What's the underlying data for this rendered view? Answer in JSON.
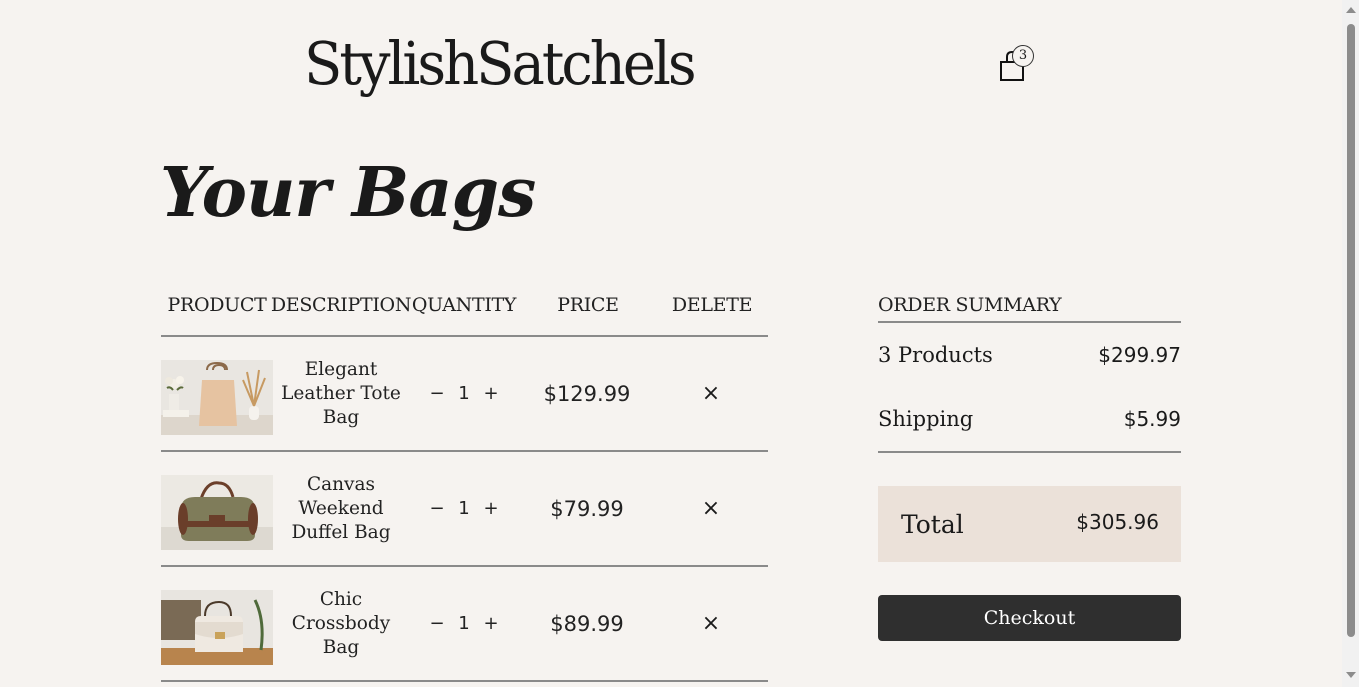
{
  "header": {
    "brand": "StylishSatchels",
    "cart_count": "3"
  },
  "page_title": "Your Bags",
  "table": {
    "headers": {
      "product": "PRODUCT",
      "description": "DESCRIPTION",
      "quantity": "QUANTITY",
      "price": "PRICE",
      "delete": "DELETE"
    },
    "rows": [
      {
        "description": "Elegant Leather Tote Bag",
        "qty_minus": "−",
        "quantity": "1",
        "qty_plus": "+",
        "price": "$129.99",
        "delete": "×"
      },
      {
        "description": "Canvas Weekend Duffel Bag",
        "qty_minus": "−",
        "quantity": "1",
        "qty_plus": "+",
        "price": "$79.99",
        "delete": "×"
      },
      {
        "description": "Chic Crossbody Bag",
        "qty_minus": "−",
        "quantity": "1",
        "qty_plus": "+",
        "price": "$89.99",
        "delete": "×"
      }
    ]
  },
  "summary": {
    "title": "ORDER SUMMARY",
    "products_label": "3 Products",
    "products_value": "$299.97",
    "shipping_label": "Shipping",
    "shipping_value": "$5.99",
    "total_label": "Total",
    "total_value": "$305.96",
    "checkout_label": "Checkout"
  },
  "colors": {
    "background": "#f6f3f0",
    "total_box": "#ebe1d9",
    "checkout_button": "#2f2f2f",
    "divider": "#8a8a8a"
  }
}
